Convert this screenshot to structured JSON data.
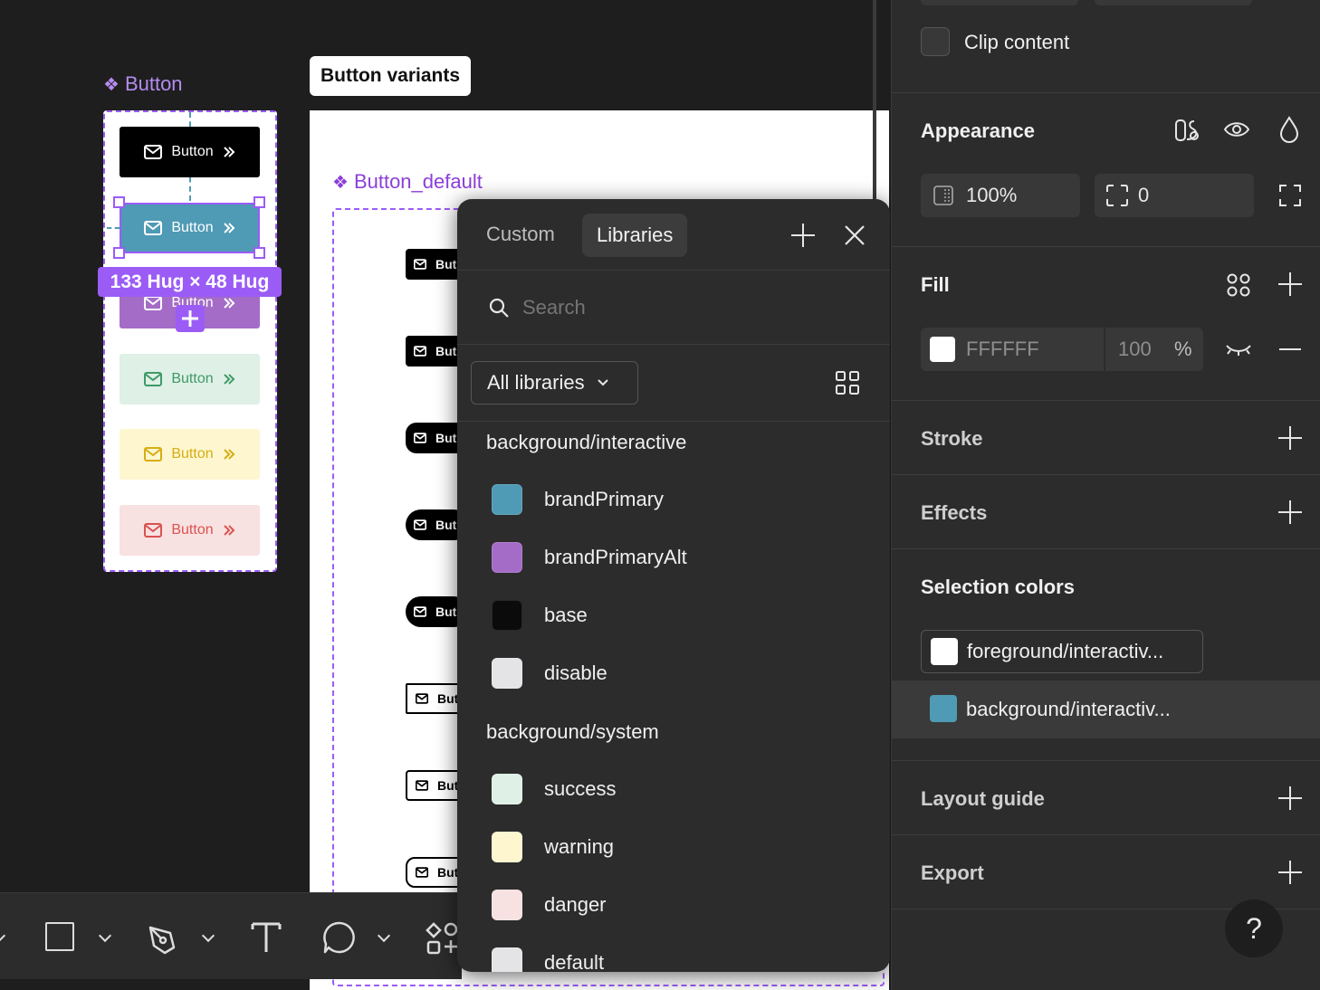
{
  "canvas": {
    "component_label": "Button",
    "frame_tag": "Button variants",
    "frame_label": "Button_default",
    "size_badge": "133 Hug × 48 Hug",
    "button_label": "Button",
    "button_short": "But",
    "variant_colors": {
      "black": "#000000",
      "blue": "#4f9ab5",
      "purple": "#a46cc7",
      "green": "#dff0e6",
      "yellow": "#fdf6cf",
      "red": "#f8e1e1",
      "selection": "#9b5cf6"
    }
  },
  "picker": {
    "tabs": [
      {
        "label": "Custom",
        "active": false
      },
      {
        "label": "Libraries",
        "active": true
      }
    ],
    "search_placeholder": "Search",
    "library_select": "All libraries",
    "groups": [
      {
        "title": "background/interactive",
        "items": [
          {
            "name": "brandPrimary",
            "color": "#4f9ab5"
          },
          {
            "name": "brandPrimaryAlt",
            "color": "#a46cc7"
          },
          {
            "name": "base",
            "color": "#0b0b0b"
          },
          {
            "name": "disable",
            "color": "#e4e4e7"
          }
        ]
      },
      {
        "title": "background/system",
        "items": [
          {
            "name": "success",
            "color": "#dff0e6"
          },
          {
            "name": "warning",
            "color": "#fdf6cf"
          },
          {
            "name": "danger",
            "color": "#f8e1e1"
          },
          {
            "name": "default",
            "color": "#e4e4e7"
          }
        ]
      }
    ]
  },
  "panel": {
    "clip_content": "Clip content",
    "appearance": {
      "title": "Appearance",
      "opacity": "100%",
      "radius": "0"
    },
    "fill": {
      "title": "Fill",
      "hex": "FFFFFF",
      "opacity": "100",
      "unit": "%"
    },
    "stroke": "Stroke",
    "effects": "Effects",
    "selection_colors": {
      "title": "Selection colors",
      "items": [
        {
          "label": "foreground/interactiv...",
          "color": "#ffffff"
        },
        {
          "label": "background/interactiv...",
          "color": "#4f9ab5"
        }
      ]
    },
    "layout_guide": "Layout guide",
    "export": "Export",
    "help": "?"
  }
}
